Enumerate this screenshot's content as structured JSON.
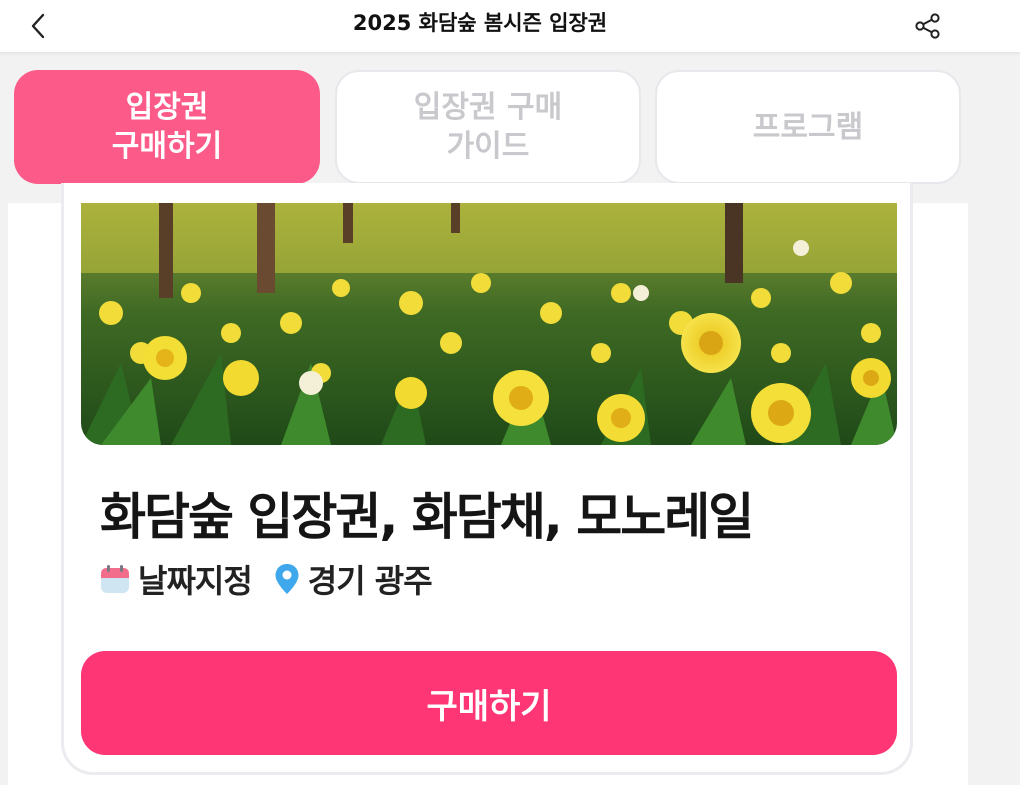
{
  "header": {
    "title": "2025 화담숲 봄시즌 입장권",
    "back_icon": "chevron-left-icon",
    "share_icon": "share-icon"
  },
  "tabs": [
    {
      "label": "입장권\n구매하기",
      "active": true
    },
    {
      "label": "입장권 구매\n가이드",
      "active": false
    },
    {
      "label": "프로그램",
      "active": false
    }
  ],
  "product": {
    "title": "화담숲 입장권, 화담채, 모노레일",
    "date_type": "날짜지정",
    "location": "경기 광주",
    "date_icon": "calendar-icon",
    "location_icon": "location-pin-icon"
  },
  "actions": {
    "buy_label": "구매하기"
  },
  "colors": {
    "tab_active_bg": "#fc5b8a",
    "buy_button_bg": "#fe3676",
    "inactive_tab_text": "#c9c9cd"
  }
}
